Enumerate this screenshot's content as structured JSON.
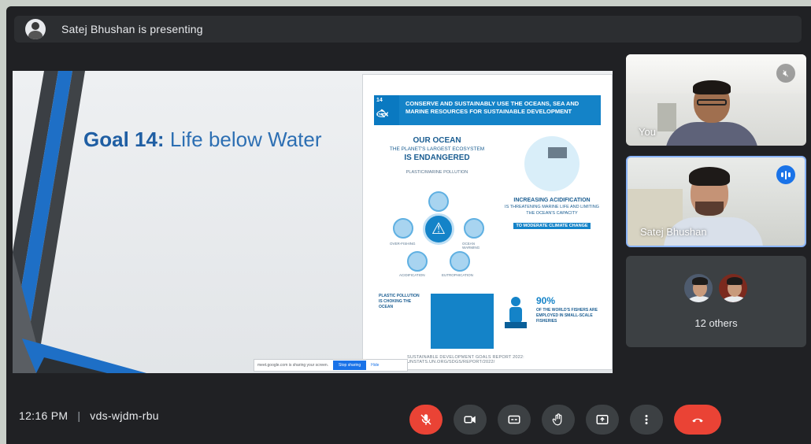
{
  "presenter": {
    "name_text": "Satej Bhushan is presenting"
  },
  "slide": {
    "title_bold": "Goal 14:",
    "title_rest": " Life below Water",
    "infographic": {
      "badge_number": "14",
      "headline": "CONSERVE AND SUSTAINABLY USE THE OCEANS, SEA AND MARINE RESOURCES FOR SUSTAINABLE DEVELOPMENT",
      "left_heading_1": "OUR OCEAN",
      "left_heading_2": "THE PLANET'S LARGEST ECOSYSTEM",
      "left_heading_3": "IS ENDANGERED",
      "left_caption": "PLASTIC/MARINE POLLUTION",
      "cycle_labels": [
        "OVER-FISHING",
        "OCEAN WARMING",
        "ACIDIFICATION",
        "EUTROPHICATION"
      ],
      "right_title": "INCREASING ACIDIFICATION",
      "right_body": "IS THREATENING MARINE LIFE AND LIMITING THE OCEAN'S CAPACITY",
      "right_highlight": "TO MODERATE CLIMATE CHANGE",
      "bottom_left_text": "PLASTIC POLLUTION IS CHOKING THE OCEAN",
      "bottom_right_pct": "90%",
      "bottom_right_text": "OF THE WORLD'S FISHERS ARE EMPLOYED IN SMALL-SCALE FISHERIES",
      "footer": "SUSTAINABLE DEVELOPMENT GOALS REPORT 2022: UNSTATS.UN.ORG/SDGS/REPORT/2022/"
    },
    "share_bar": {
      "message": "meet.google.com is sharing your screen.",
      "stop_label": "Stop sharing",
      "hide_label": "Hide"
    }
  },
  "participants": {
    "you_label": "You",
    "speaker_label": "Satej Bhushan",
    "others_label": "12 others"
  },
  "bottom": {
    "time": "12:16 PM",
    "meeting_code": "vds-wjdm-rbu"
  },
  "colors": {
    "accent": "#1a73e8",
    "danger": "#ea4335",
    "background": "#202124"
  }
}
